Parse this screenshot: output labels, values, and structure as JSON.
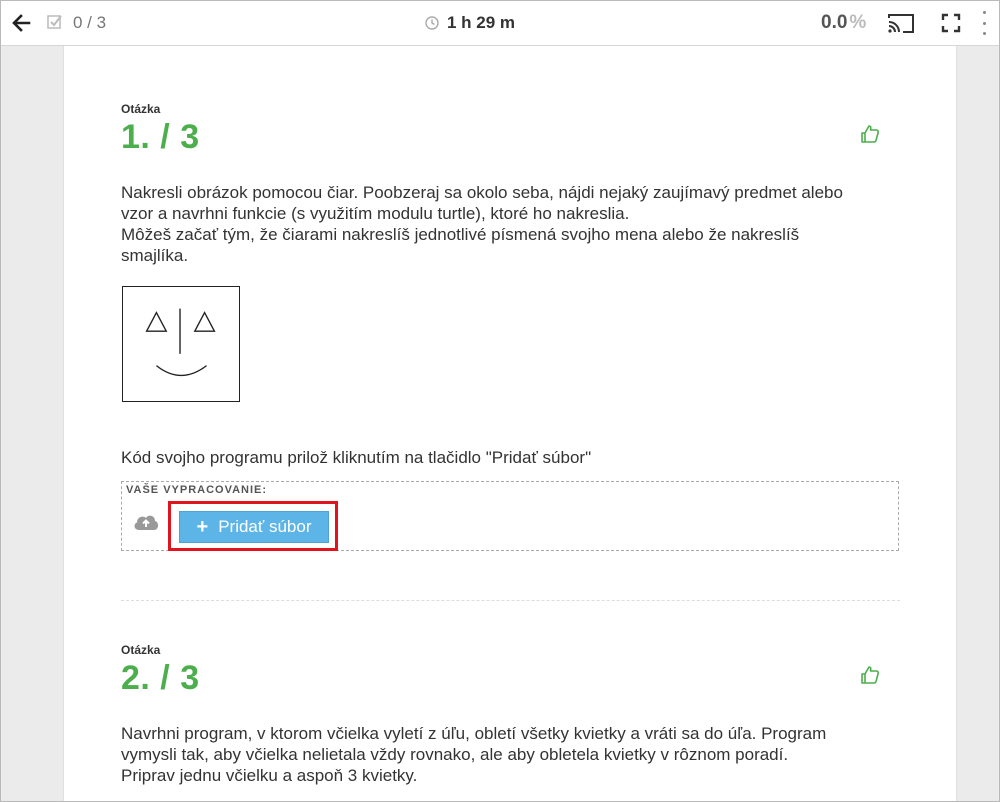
{
  "toolbar": {
    "progress": "0 / 3",
    "timer": "1 h 29 m",
    "score_value": "0.0",
    "score_unit": "%"
  },
  "question1": {
    "label": "Otázka",
    "number": "1. / 3",
    "lines": [
      "Nakresli obrázok pomocou čiar. Poobzeraj sa okolo seba, nájdi nejaký zaujímavý predmet alebo",
      "vzor a navrhni funkcie (s využitím modulu turtle), ktoré ho nakreslia.",
      "Môžeš začať tým, že čiarami nakreslíš jednotlivé písmená svojho mena alebo že nakreslíš",
      "smajlíka."
    ],
    "attach_instruction": "Kód svojho programu prilož kliknutím na tlačidlo \"Pridať súbor\"",
    "submission_label": "VAŠE VYPRACOVANIE:",
    "add_file_label": "Pridať súbor"
  },
  "question2": {
    "label": "Otázka",
    "number": "2. / 3",
    "lines": [
      "Navrhni program, v ktorom včielka vyletí z úľu, obletí všetky kvietky a vráti sa do úľa. Program",
      "vymysli tak, aby včielka nelietala vždy rovnako, ale aby obletela kvietky v rôznom poradí.",
      "Priprav jednu včielku a aspoň 3 kvietky."
    ]
  },
  "colors": {
    "accent_green": "#4cae4c",
    "button_blue": "#5db4e6",
    "highlight_red": "#e0141c"
  }
}
